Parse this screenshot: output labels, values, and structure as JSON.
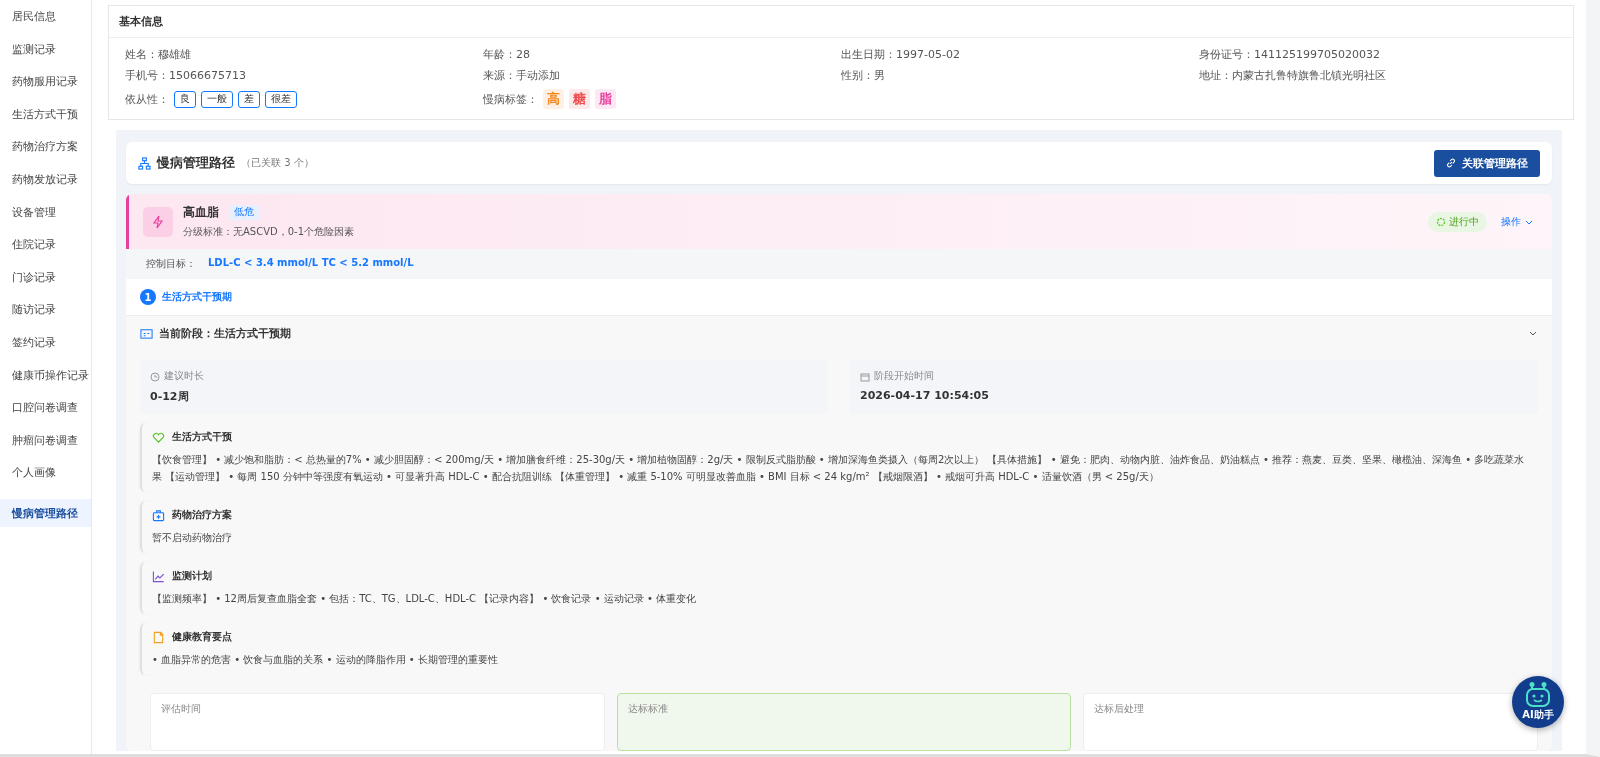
{
  "sidebar": {
    "items": [
      {
        "label": "居民信息",
        "selected": false
      },
      {
        "label": "监测记录",
        "selected": false
      },
      {
        "label": "药物服用记录",
        "selected": false
      },
      {
        "label": "生活方式干预",
        "selected": false
      },
      {
        "label": "药物治疗方案",
        "selected": false
      },
      {
        "label": "药物发放记录",
        "selected": false
      },
      {
        "label": "设备管理",
        "selected": false
      },
      {
        "label": "住院记录",
        "selected": false
      },
      {
        "label": "门诊记录",
        "selected": false
      },
      {
        "label": "随访记录",
        "selected": false
      },
      {
        "label": "签约记录",
        "selected": false
      },
      {
        "label": "健康币操作记录",
        "selected": false
      },
      {
        "label": "口腔问卷调查",
        "selected": false
      },
      {
        "label": "肿瘤问卷调查",
        "selected": false
      },
      {
        "label": "个人画像",
        "selected": false
      },
      {
        "label": "慢病管理路径",
        "selected": true
      }
    ]
  },
  "basic_info": {
    "title": "基本信息",
    "fields": [
      {
        "label": "姓名：",
        "value": "穆雄雄"
      },
      {
        "label": "年龄：",
        "value": "28"
      },
      {
        "label": "出生日期：",
        "value": "1997-05-02"
      },
      {
        "label": "身份证号：",
        "value": "141125199705020032"
      },
      {
        "label": "手机号：",
        "value": "15066675713"
      },
      {
        "label": "来源：",
        "value": "手动添加"
      },
      {
        "label": "性别：",
        "value": "男"
      },
      {
        "label": "地址：",
        "value": "内蒙古扎鲁特旗鲁北镇光明社区"
      }
    ],
    "compliance": {
      "label": "依从性：",
      "options": [
        "良",
        "一般",
        "差",
        "很差"
      ]
    },
    "chronic_tags": {
      "label": "慢病标签：",
      "tags": [
        {
          "text": "高",
          "color": "#f5871f"
        },
        {
          "text": "糖",
          "color": "#f04848"
        },
        {
          "text": "脂",
          "color": "#e83e9c"
        }
      ]
    }
  },
  "path": {
    "title": "慢病管理路径",
    "count": "（已关联 3 个）",
    "link_button": "关联管理路径",
    "disease": {
      "name": "高血脂",
      "risk": "低危",
      "criteria": "分级标准：无ASCVD，0-1个危险因素",
      "status": "进行中",
      "action": "操作",
      "goal_label": "控制目标：",
      "goal": "LDL-C < 3.4 mmol/L TC < 5.2 mmol/L"
    },
    "steps": [
      {
        "number": "1",
        "label": "生活方式干预期",
        "selected": true
      }
    ],
    "stage": {
      "title": "当前阶段：生活方式干预期",
      "expanded": true,
      "duration_label": "建议时长",
      "duration": "0-12周",
      "start_label": "阶段开始时间",
      "start": "2026-04-17 10:54:05",
      "sections": [
        {
          "kind": "heart",
          "title": "生活方式干预",
          "text": "【饮食管理】 • 减少饱和脂肪：< 总热量的7% • 减少胆固醇：< 200mg/天 • 增加膳食纤维：25-30g/天 • 增加植物固醇：2g/天 • 限制反式脂肪酸 • 增加深海鱼类摄入（每周2次以上） 【具体措施】 • 避免：肥肉、动物内脏、油炸食品、奶油糕点 • 推荐：燕麦、豆类、坚果、橄榄油、深海鱼 • 多吃蔬菜水果 【运动管理】 • 每周 150 分钟中等强度有氧运动 • 可显著升高 HDL-C • 配合抗阻训练 【体重管理】 • 减重 5-10% 可明显改善血脂 • BMI 目标 < 24 kg/m² 【戒烟限酒】 • 戒烟可升高 HDL-C • 适量饮酒（男 < 25g/天）"
        },
        {
          "kind": "medicine",
          "title": "药物治疗方案",
          "text": "暂不启动药物治疗"
        },
        {
          "kind": "chart",
          "title": "监测计划",
          "text": "【监测频率】 • 12周后复查血脂全套 • 包括：TC、TG、LDL-C、HDL-C 【记录内容】 • 饮食记录 • 运动记录 • 体重变化"
        },
        {
          "kind": "book",
          "title": "健康教育要点",
          "text": "• 血脂异常的危害 • 饮食与血脂的关系 • 运动的降脂作用 • 长期管理的重要性"
        }
      ],
      "bottom_cards": [
        {
          "label": "评估时间",
          "highlighted": false
        },
        {
          "label": "达标标准",
          "highlighted": true
        },
        {
          "label": "达标后处理",
          "highlighted": false
        }
      ]
    }
  },
  "assistant": {
    "label": "AI助手"
  }
}
